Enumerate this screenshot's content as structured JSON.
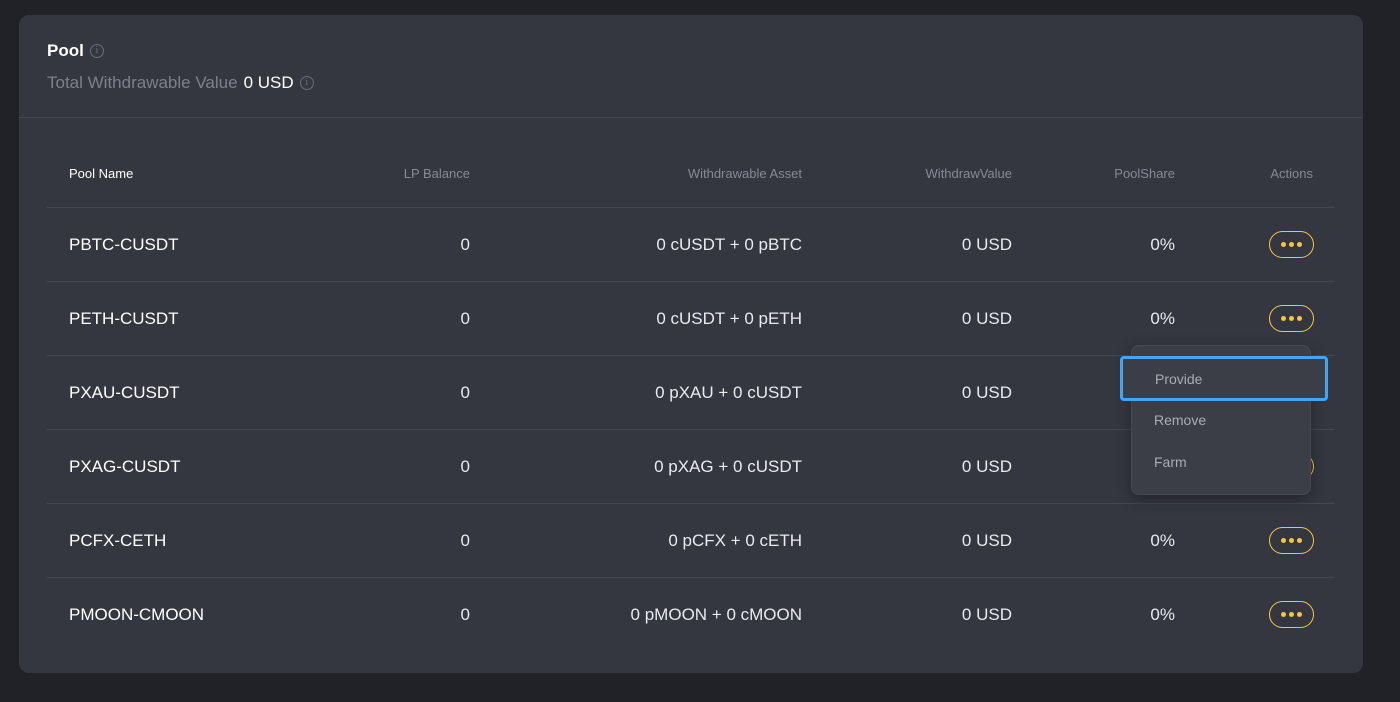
{
  "header": {
    "title": "Pool",
    "twv_label": "Total Withdrawable Value",
    "twv_value": "0 USD"
  },
  "columns": {
    "name": "Pool Name",
    "lp": "LP Balance",
    "asset": "Withdrawable Asset",
    "value": "WithdrawValue",
    "share": "PoolShare",
    "actions": "Actions"
  },
  "rows": [
    {
      "name": "PBTC-CUSDT",
      "lp": "0",
      "asset": "0 cUSDT + 0 pBTC",
      "value": "0 USD",
      "share": "0%"
    },
    {
      "name": "PETH-CUSDT",
      "lp": "0",
      "asset": "0 cUSDT + 0 pETH",
      "value": "0 USD",
      "share": "0%"
    },
    {
      "name": "PXAU-CUSDT",
      "lp": "0",
      "asset": "0 pXAU + 0 cUSDT",
      "value": "0 USD",
      "share": ""
    },
    {
      "name": "PXAG-CUSDT",
      "lp": "0",
      "asset": "0 pXAG + 0 cUSDT",
      "value": "0 USD",
      "share": ""
    },
    {
      "name": "PCFX-CETH",
      "lp": "0",
      "asset": "0 pCFX + 0 cETH",
      "value": "0 USD",
      "share": "0%"
    },
    {
      "name": "PMOON-CMOON",
      "lp": "0",
      "asset": "0 pMOON + 0 cMOON",
      "value": "0 USD",
      "share": "0%"
    }
  ],
  "dropdown": {
    "items": [
      "Provide",
      "Remove",
      "Farm"
    ],
    "highlighted": "Provide"
  },
  "colors": {
    "accent": "#f6c447",
    "highlight": "#4aa3ea",
    "card": "#353740",
    "background": "#212228"
  },
  "icons": {
    "info": "info-icon",
    "more": "more-icon"
  }
}
